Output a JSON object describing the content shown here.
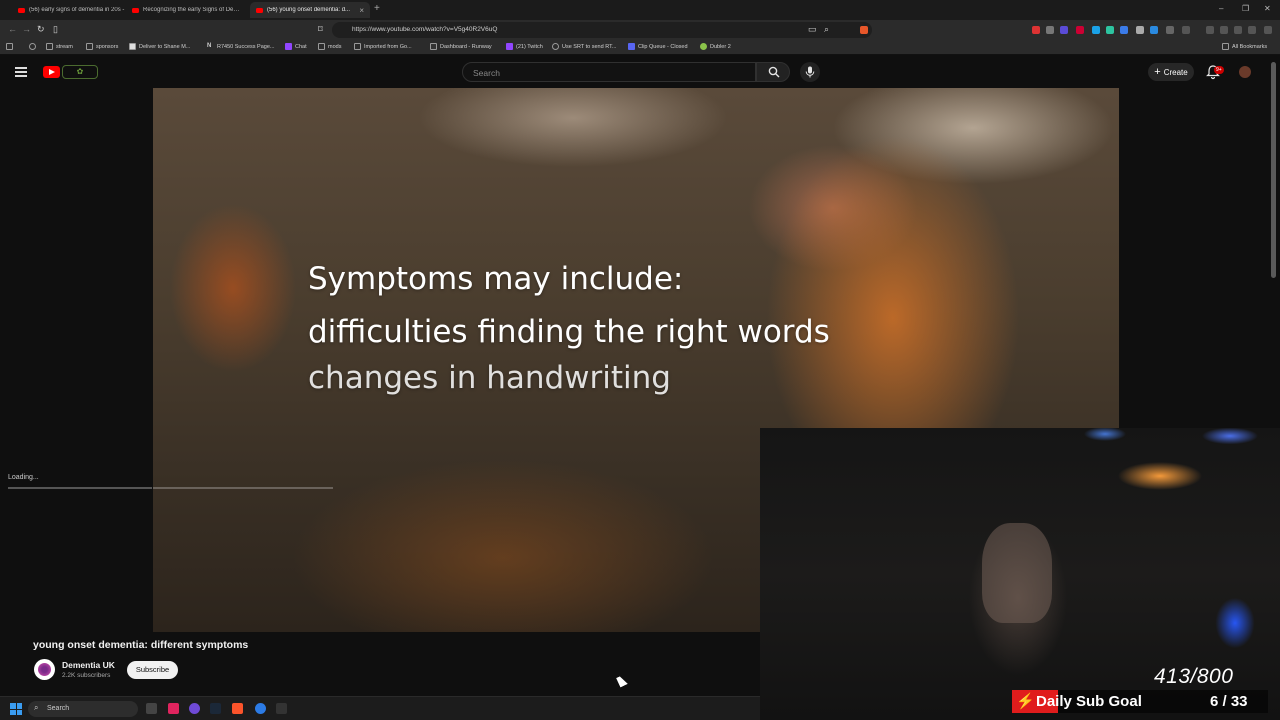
{
  "browser": {
    "tabs": [
      {
        "title": "(56) early signs of dementia in 20s -"
      },
      {
        "title": "Recognizing the early Signs of Dem..."
      },
      {
        "title": "(56) young onset dementia: d..."
      }
    ],
    "url": "https://www.youtube.com/watch?v=V5g40R2V6uQ",
    "bookmarks": [
      "stream",
      "sponsors",
      "Deliver to Shane M...",
      "R7450 Success Page...",
      "Chat",
      "mods",
      "Imported from Go...",
      "Dashboard - Runway",
      "(21) Twitch",
      "Use SRT to send RT...",
      "Clip Queue - Closed",
      "Dubler 2"
    ],
    "all_bookmarks": "All Bookmarks"
  },
  "youtube": {
    "search_placeholder": "Search",
    "create_label": "Create",
    "notif_count": "9+",
    "loading_text": "Loading..."
  },
  "video": {
    "captions": [
      "Symptoms may include:",
      "difficulties finding the right words",
      "changes in handwriting"
    ],
    "title": "young onset dementia: different symptoms",
    "channel": "Dementia UK",
    "subscribers": "2.2K subscribers",
    "subscribe_label": "Subscribe"
  },
  "stream_overlay": {
    "follower_count": "413/800",
    "goal_label": "Daily Sub Goal",
    "goal_progress": "6 / 33",
    "goal_fraction": 0.18,
    "goal_color": "#e01c1c"
  },
  "taskbar": {
    "search_label": "Search"
  },
  "colors": {
    "youtube_red": "#ff0000",
    "background": "#0f0f0f"
  }
}
